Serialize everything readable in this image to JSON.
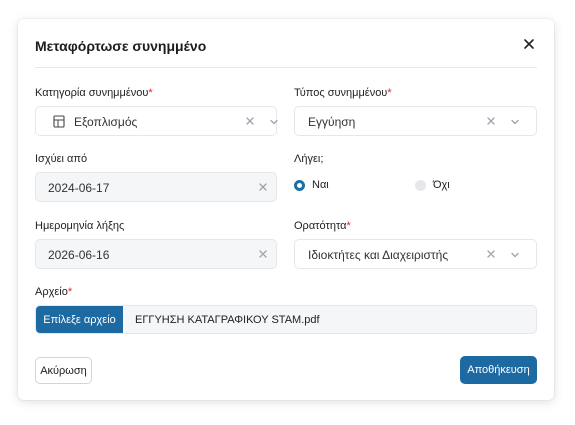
{
  "modal": {
    "title": "Μεταφόρτωσε συνημμένο"
  },
  "category": {
    "label": "Κατηγορία συνημμένου",
    "required_mark": "*",
    "value": "Εξοπλισμός",
    "icon": "building-icon"
  },
  "type": {
    "label": "Τύπος συνημμένου",
    "required_mark": "*",
    "value": "Εγγύηση"
  },
  "valid_from": {
    "label": "Ισχύει από",
    "value": "2024-06-17"
  },
  "expires": {
    "label": "Λήγει;",
    "options": [
      {
        "label": "Ναι",
        "selected": true
      },
      {
        "label": "Όχι",
        "selected": false
      }
    ]
  },
  "expiry_date": {
    "label": "Ημερομηνία λήξης",
    "value": "2026-06-16"
  },
  "visibility": {
    "label": "Ορατότητα",
    "required_mark": "*",
    "value": "Ιδιοκτήτες και Διαχειριστής"
  },
  "file": {
    "label": "Αρχείο",
    "required_mark": "*",
    "button_label": "Επίλεξε αρχείο",
    "file_name": "ΕΓΓΥΗΣΗ ΚΑΤΑΓΡΑΦΙΚΟΥ STAM.pdf"
  },
  "actions": {
    "cancel_label": "Ακύρωση",
    "save_label": "Αποθήκευση"
  },
  "colors": {
    "primary": "#1d6aa3",
    "required": "#dc2626",
    "field_disabled_bg": "#f5f6f7"
  }
}
